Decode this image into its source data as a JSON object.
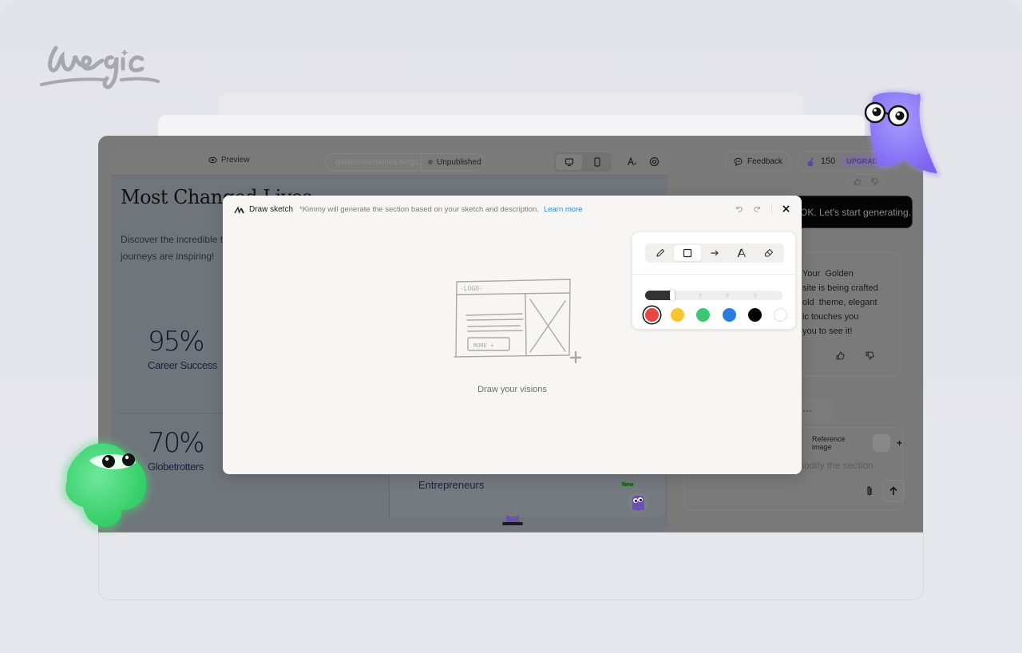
{
  "brand": {
    "logo_text": "wegic"
  },
  "editor": {
    "toolbar": {
      "preview_label": "Preview",
      "site_url": "golden-memories.wegic.app",
      "publish_status": "Unpublished",
      "device_options": [
        "desktop",
        "mobile"
      ],
      "selected_device": "desktop"
    },
    "page": {
      "title": "Most Changed Lives",
      "subtitle": "Discover the incredible transformations... journeys are inspiring!",
      "subtitle_visible_1": "Discover the incredible t",
      "subtitle_visible_2": "journeys are inspiring!",
      "stats": [
        {
          "value": "95%",
          "label": "Career Success"
        },
        {
          "value": "70%",
          "label": "Globetrotters"
        }
      ],
      "card_label": "Entrepreneurs",
      "new_badge": "New"
    }
  },
  "chat": {
    "feedback_label": "Feedback",
    "credits": "150",
    "upgrade_label": "UPGRADE",
    "bot_reply": "OK. Let's start generating.",
    "message_lines": [
      "Your  Golden",
      "site is being crafted",
      "old  theme, elegant",
      "ic touches you",
      "you to see it!"
    ],
    "more_label": "···",
    "reference_image_label": "Reference image",
    "add_label": "+",
    "input_placeholder": "modify the section"
  },
  "modal": {
    "title": "Draw sketch",
    "hint": "*Kimmy will generate the section based on your sketch and description.",
    "learn_more": "Learn more",
    "caption": "Draw your visions",
    "sketch_logo": "-LOGO-",
    "sketch_button": "MORE +",
    "tools": [
      {
        "name": "pencil",
        "active": false
      },
      {
        "name": "rectangle",
        "active": true
      },
      {
        "name": "arrow",
        "active": false
      },
      {
        "name": "text",
        "active": false
      },
      {
        "name": "eraser",
        "active": false
      }
    ],
    "stroke_width": {
      "value": 0.2,
      "ticks": [
        0.4,
        0.6,
        0.8
      ]
    },
    "colors": [
      {
        "name": "red",
        "hex": "#e84545",
        "selected": true
      },
      {
        "name": "yellow",
        "hex": "#f9c52c",
        "selected": false
      },
      {
        "name": "green",
        "hex": "#3bc774",
        "selected": false
      },
      {
        "name": "blue",
        "hex": "#2b7de1",
        "selected": false
      },
      {
        "name": "black",
        "hex": "#050505",
        "selected": false
      },
      {
        "name": "white",
        "hex": "#ffffff",
        "selected": false
      }
    ]
  }
}
